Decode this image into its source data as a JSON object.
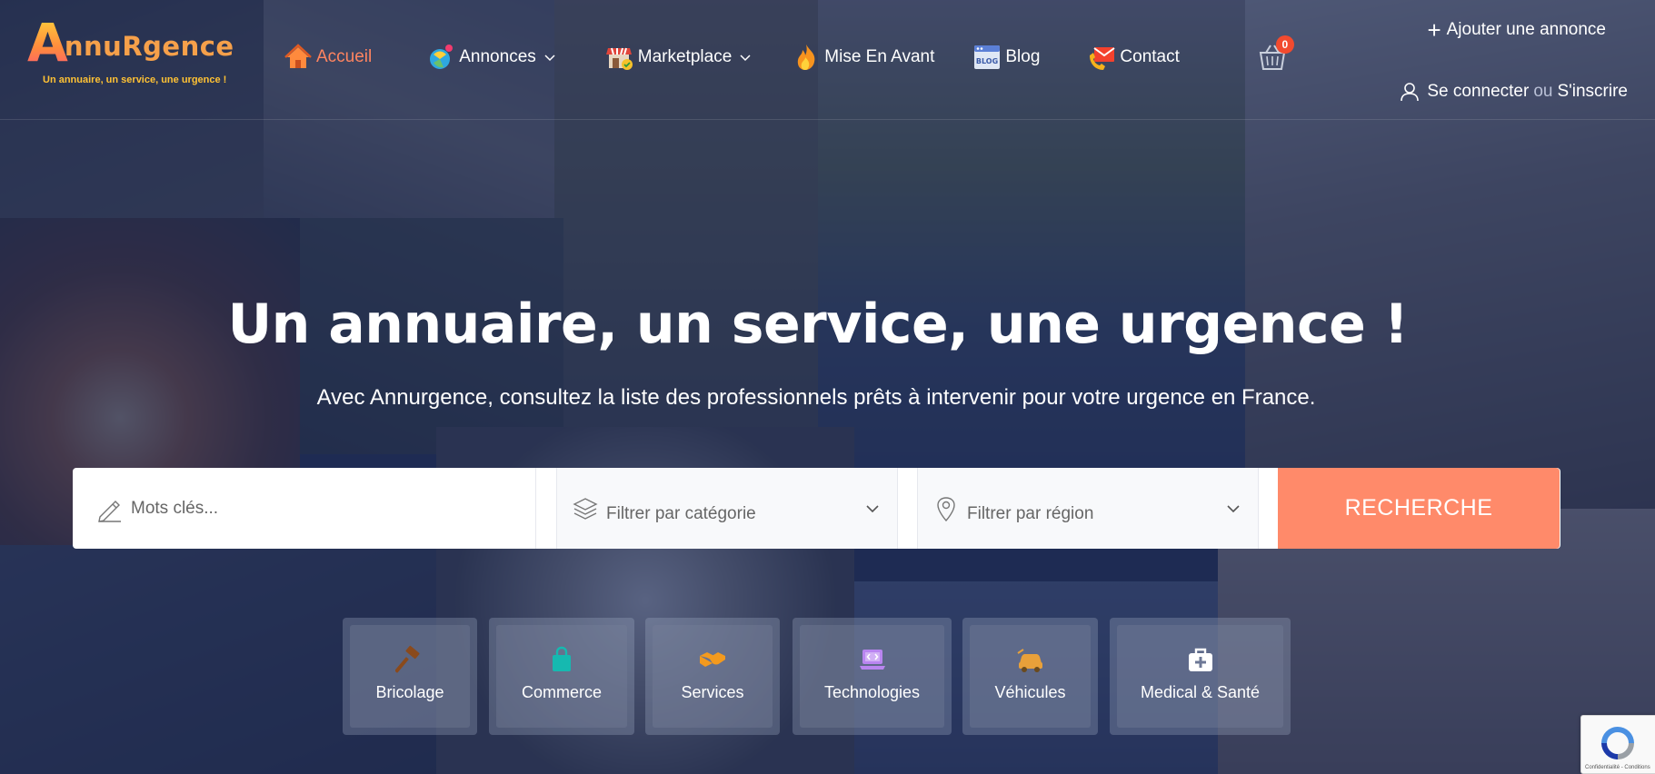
{
  "brand": {
    "logo_letter": "A",
    "logo_rest": "nnuRgence",
    "tagline": "Un annuaire, un service, une urgence !"
  },
  "nav": {
    "items": [
      {
        "label": "Accueil",
        "icon": "home-icon",
        "active": true
      },
      {
        "label": "Annonces",
        "icon": "listings-icon",
        "dropdown": true
      },
      {
        "label": "Marketplace",
        "icon": "shop-icon",
        "dropdown": true
      },
      {
        "label": "Mise En Avant",
        "icon": "flame-icon"
      },
      {
        "label": "Blog",
        "icon": "blog-icon"
      },
      {
        "label": "Contact",
        "icon": "contact-icon"
      }
    ],
    "cart_count": "0"
  },
  "header_actions": {
    "add_listing": "Ajouter une annonce",
    "login": "Se connecter",
    "or": "ou",
    "register": "S'inscrire"
  },
  "hero": {
    "title": "Un annuaire, un service, une urgence !",
    "subtitle": "Avec Annurgence, consultez la liste des professionnels prêts à intervenir pour votre urgence en France."
  },
  "search": {
    "keywords_placeholder": "Mots clés...",
    "category_placeholder": "Filtrer par catégorie",
    "region_placeholder": "Filtrer par région",
    "button": "RECHERCHE"
  },
  "categories": [
    {
      "label": "Bricolage",
      "icon": "hammer-icon",
      "color": "#8a4a1c"
    },
    {
      "label": "Commerce",
      "icon": "shopping-bag-icon",
      "color": "#16b9b0"
    },
    {
      "label": "Services",
      "icon": "handshake-icon",
      "color": "#f39a1e"
    },
    {
      "label": "Technologies",
      "icon": "laptop-code-icon",
      "color": "#b985f0"
    },
    {
      "label": "Véhicules",
      "icon": "car-icon",
      "color": "#e8a03a"
    },
    {
      "label": "Medical & Santé",
      "icon": "medical-kit-icon",
      "color": "#ffffff"
    }
  ],
  "recaptcha": {
    "text": "Confidentialité - Conditions"
  },
  "colors": {
    "accent": "#ff8a6a",
    "active_nav": "#ff8460",
    "overlay": "#1e2c58",
    "badge": "#f24a2e"
  }
}
